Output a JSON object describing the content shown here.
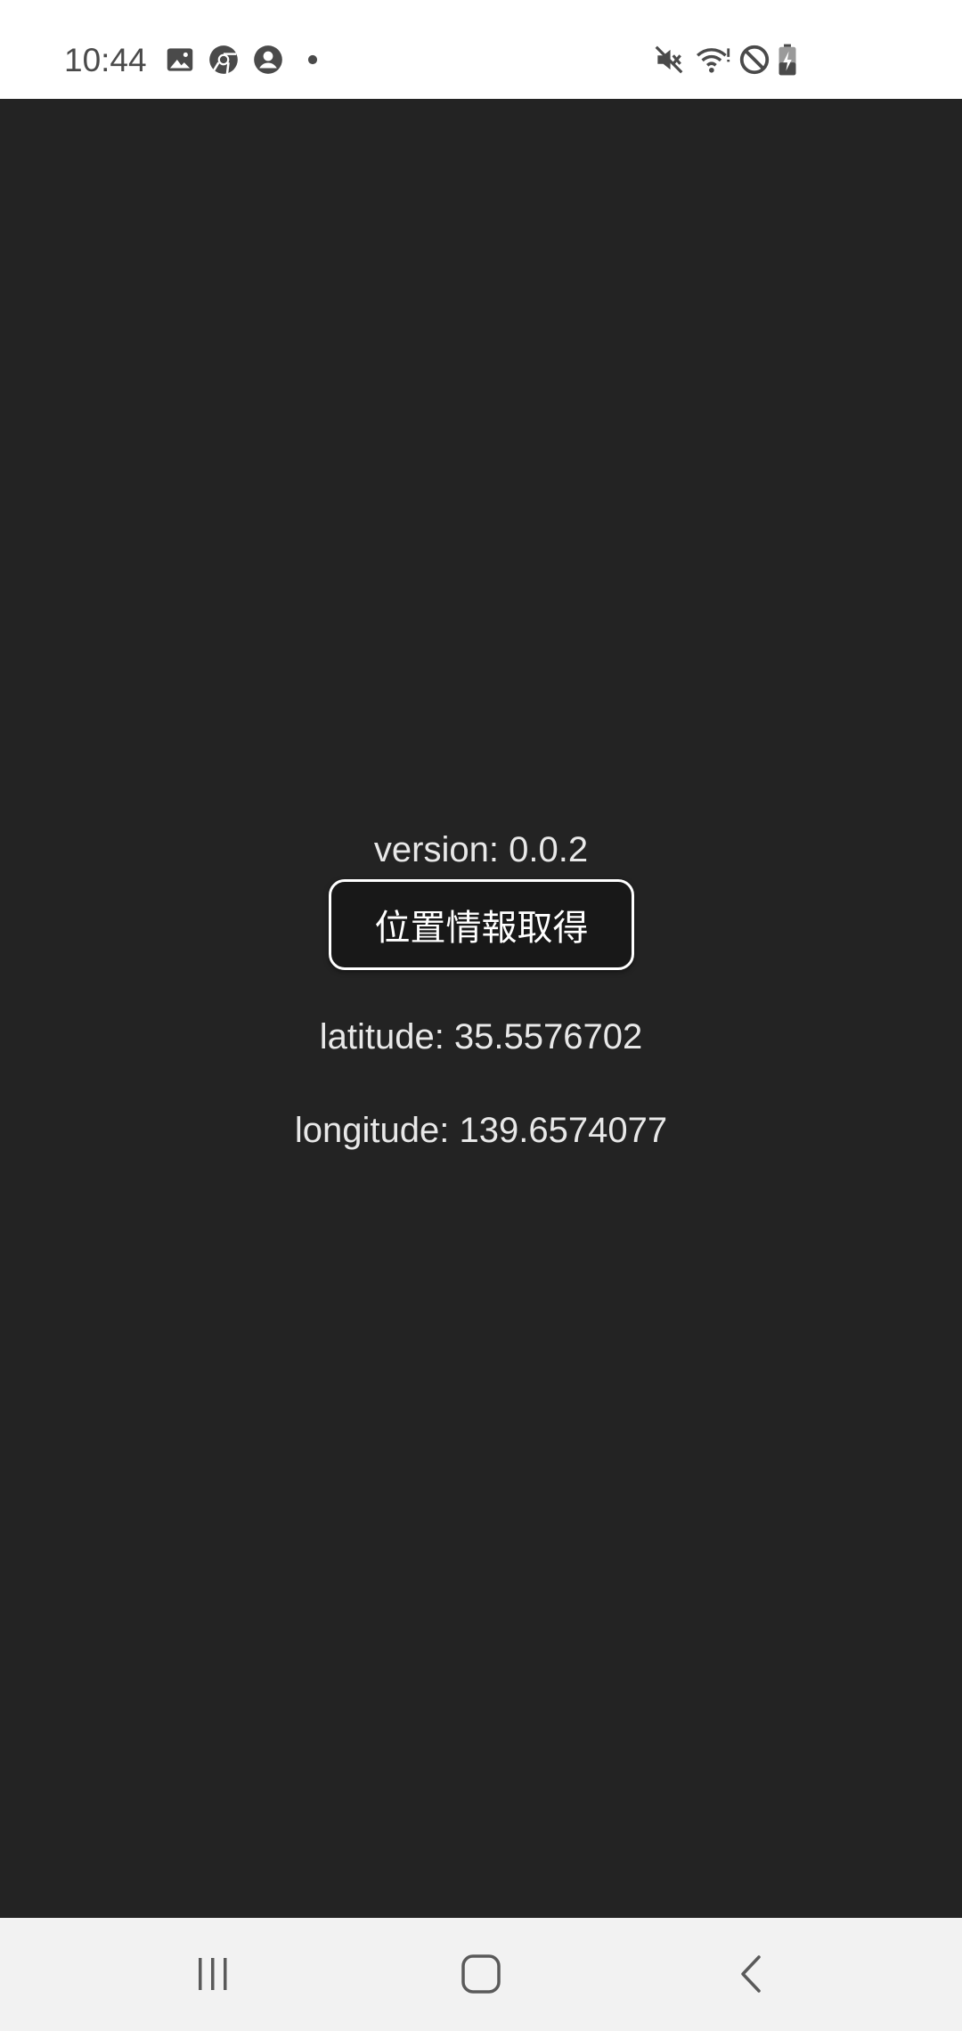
{
  "status_bar": {
    "time": "10:44",
    "left_icons": [
      "gallery-icon",
      "chrome-icon",
      "account-icon",
      "notification-dot-icon"
    ],
    "right_icons": [
      "mute-icon",
      "wifi-icon",
      "do-not-disturb-icon",
      "battery-charging-icon"
    ]
  },
  "content": {
    "version": "version: 0.0.2",
    "button_label": "位置情報取得",
    "latitude": "latitude: 35.5576702",
    "longitude": "longitude: 139.6574077"
  },
  "nav_bar": {
    "buttons": [
      "recent-apps-button",
      "home-button",
      "back-button"
    ]
  },
  "colors": {
    "background": "#232323",
    "status_bar_bg": "#ffffff",
    "nav_bar_bg": "#f2f2f2",
    "text": "#e8e8e8",
    "button_border": "#ffffff"
  }
}
